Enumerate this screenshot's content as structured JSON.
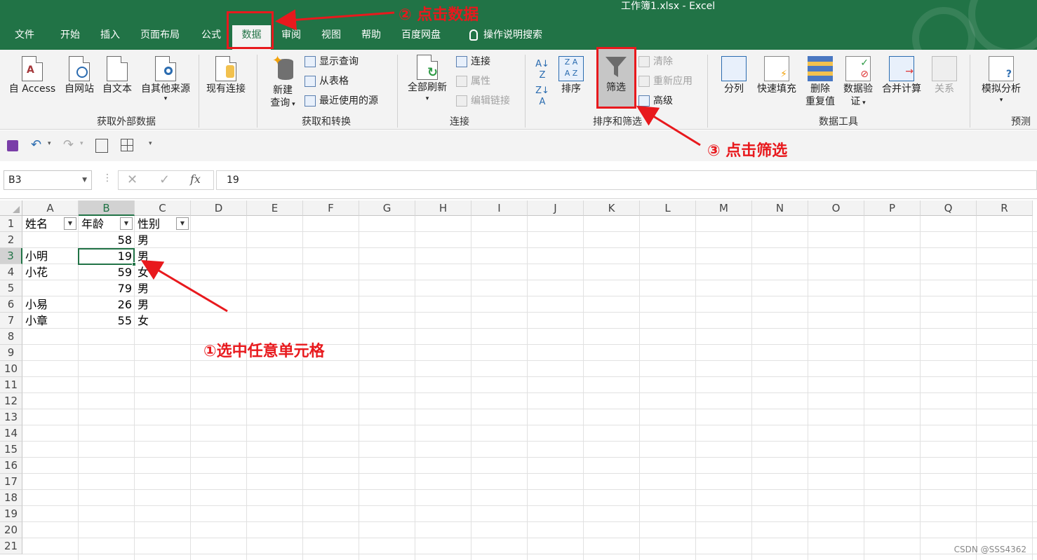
{
  "window": {
    "title": "工作簿1.xlsx  -  Excel"
  },
  "tabs": [
    {
      "label": "文件"
    },
    {
      "label": "开始"
    },
    {
      "label": "插入"
    },
    {
      "label": "页面布局"
    },
    {
      "label": "公式"
    },
    {
      "label": "数据"
    },
    {
      "label": "审阅"
    },
    {
      "label": "视图"
    },
    {
      "label": "帮助"
    },
    {
      "label": "百度网盘"
    },
    {
      "label": "操作说明搜索"
    }
  ],
  "ribbon": {
    "get_external": {
      "group": "获取外部数据",
      "access": "自 Access",
      "web": "自网站",
      "text": "自文本",
      "other": "自其他来源",
      "existing": "现有连接"
    },
    "get_transform": {
      "group": "获取和转换",
      "new_query_1": "新建",
      "new_query_2": "查询",
      "show_queries": "显示查询",
      "from_table": "从表格",
      "recent_sources": "最近使用的源"
    },
    "connections": {
      "group": "连接",
      "refresh_all": "全部刷新",
      "connections": "连接",
      "properties": "属性",
      "edit_links": "编辑链接"
    },
    "sort_filter": {
      "group": "排序和筛选",
      "sort": "排序",
      "filter": "筛选",
      "clear": "清除",
      "reapply": "重新应用",
      "advanced": "高级"
    },
    "data_tools": {
      "group": "数据工具",
      "text_to_columns": "分列",
      "flash_fill": "快速填充",
      "remove_dup_1": "删除",
      "remove_dup_2": "重复值",
      "validation_1": "数据验",
      "validation_2": "证",
      "consolidate": "合并计算",
      "relationships": "关系"
    },
    "forecast": {
      "group": "预测",
      "what_if": "模拟分析"
    }
  },
  "formula_bar": {
    "name_box": "B3",
    "fx": "fx",
    "value": "19"
  },
  "columns": [
    "A",
    "B",
    "C",
    "D",
    "E",
    "F",
    "G",
    "H",
    "I",
    "J",
    "K",
    "L",
    "M",
    "N",
    "O",
    "P",
    "Q",
    "R"
  ],
  "rows": [
    "1",
    "2",
    "3",
    "4",
    "5",
    "6",
    "7",
    "8",
    "9",
    "10",
    "11",
    "12",
    "13",
    "14",
    "15",
    "16",
    "17",
    "18",
    "19",
    "20",
    "21"
  ],
  "sheet": {
    "header": [
      "姓名",
      "年龄",
      "性别"
    ],
    "data": [
      [
        "",
        "58",
        "男"
      ],
      [
        "小明",
        "19",
        "男"
      ],
      [
        "小花",
        "59",
        "女"
      ],
      [
        "",
        "79",
        "男"
      ],
      [
        "小易",
        "26",
        "男"
      ],
      [
        "小章",
        "55",
        "女"
      ]
    ]
  },
  "annotations": {
    "step1": "①选中任意单元格",
    "step2": "② 点击数据",
    "step3": "③ 点击筛选"
  },
  "watermark": "CSDN @SSS4362",
  "colors": {
    "excel_green": "#217346",
    "annotation_red": "#e8191d"
  }
}
